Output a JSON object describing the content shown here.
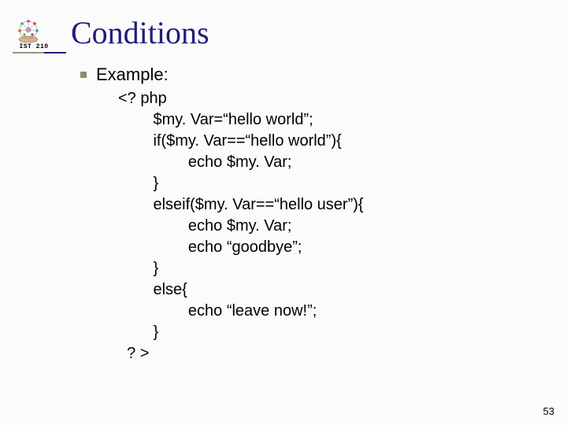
{
  "logo": {
    "label": "IST 210"
  },
  "title": "Conditions",
  "bullet": "Example:",
  "code": {
    "l0": "<? php",
    "l1": "$my. Var=“hello world”;",
    "l2": "if($my. Var==“hello world”){",
    "l3": "echo $my. Var;",
    "l4": "}",
    "l5": "elseif($my. Var==“hello user”){",
    "l6": "echo $my. Var;",
    "l7": "echo “goodbye”;",
    "l8": "}",
    "l9": "else{",
    "l10": "echo “leave now!”;",
    "l11": "}",
    "l12": "? >"
  },
  "slide_number": "53"
}
